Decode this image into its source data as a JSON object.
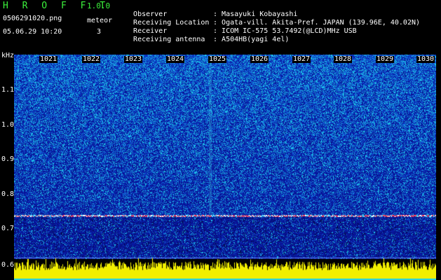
{
  "header": {
    "app_title": "H R O F F T",
    "version": "1.0.0",
    "file_name": "0506291020.png",
    "datetime": "05.06.29 10:20",
    "meteor_label": "meteor",
    "meteor_count": "3"
  },
  "info": [
    {
      "label": "Observer",
      "value": "Masayuki Kobayashi"
    },
    {
      "label": "Receiving Location",
      "value": "Ogata-vill. Akita-Pref. JAPAN (139.96E, 40.02N)"
    },
    {
      "label": "Receiver",
      "value": "ICOM IC-575 53.7492(@LCD)MHz USB"
    },
    {
      "label": "Receiving antenna",
      "value": "A504HB(yagi 4el)"
    }
  ],
  "spectrogram": {
    "y_unit": "kHz",
    "y_ticks": [
      "1.1",
      "1.0",
      "0.9",
      "0.8",
      "0.7",
      "0.6"
    ],
    "x_ticks": [
      "1021",
      "1022",
      "1023",
      "1024",
      "1025",
      "1026",
      "1027",
      "1028",
      "1029",
      "1030"
    ],
    "carrier_khz": 0.74,
    "colors": {
      "background": "#0a1ba0",
      "noise_hi": "#2ad0e0",
      "carrier": "#ff4060",
      "meter": "#f2ef00"
    }
  }
}
